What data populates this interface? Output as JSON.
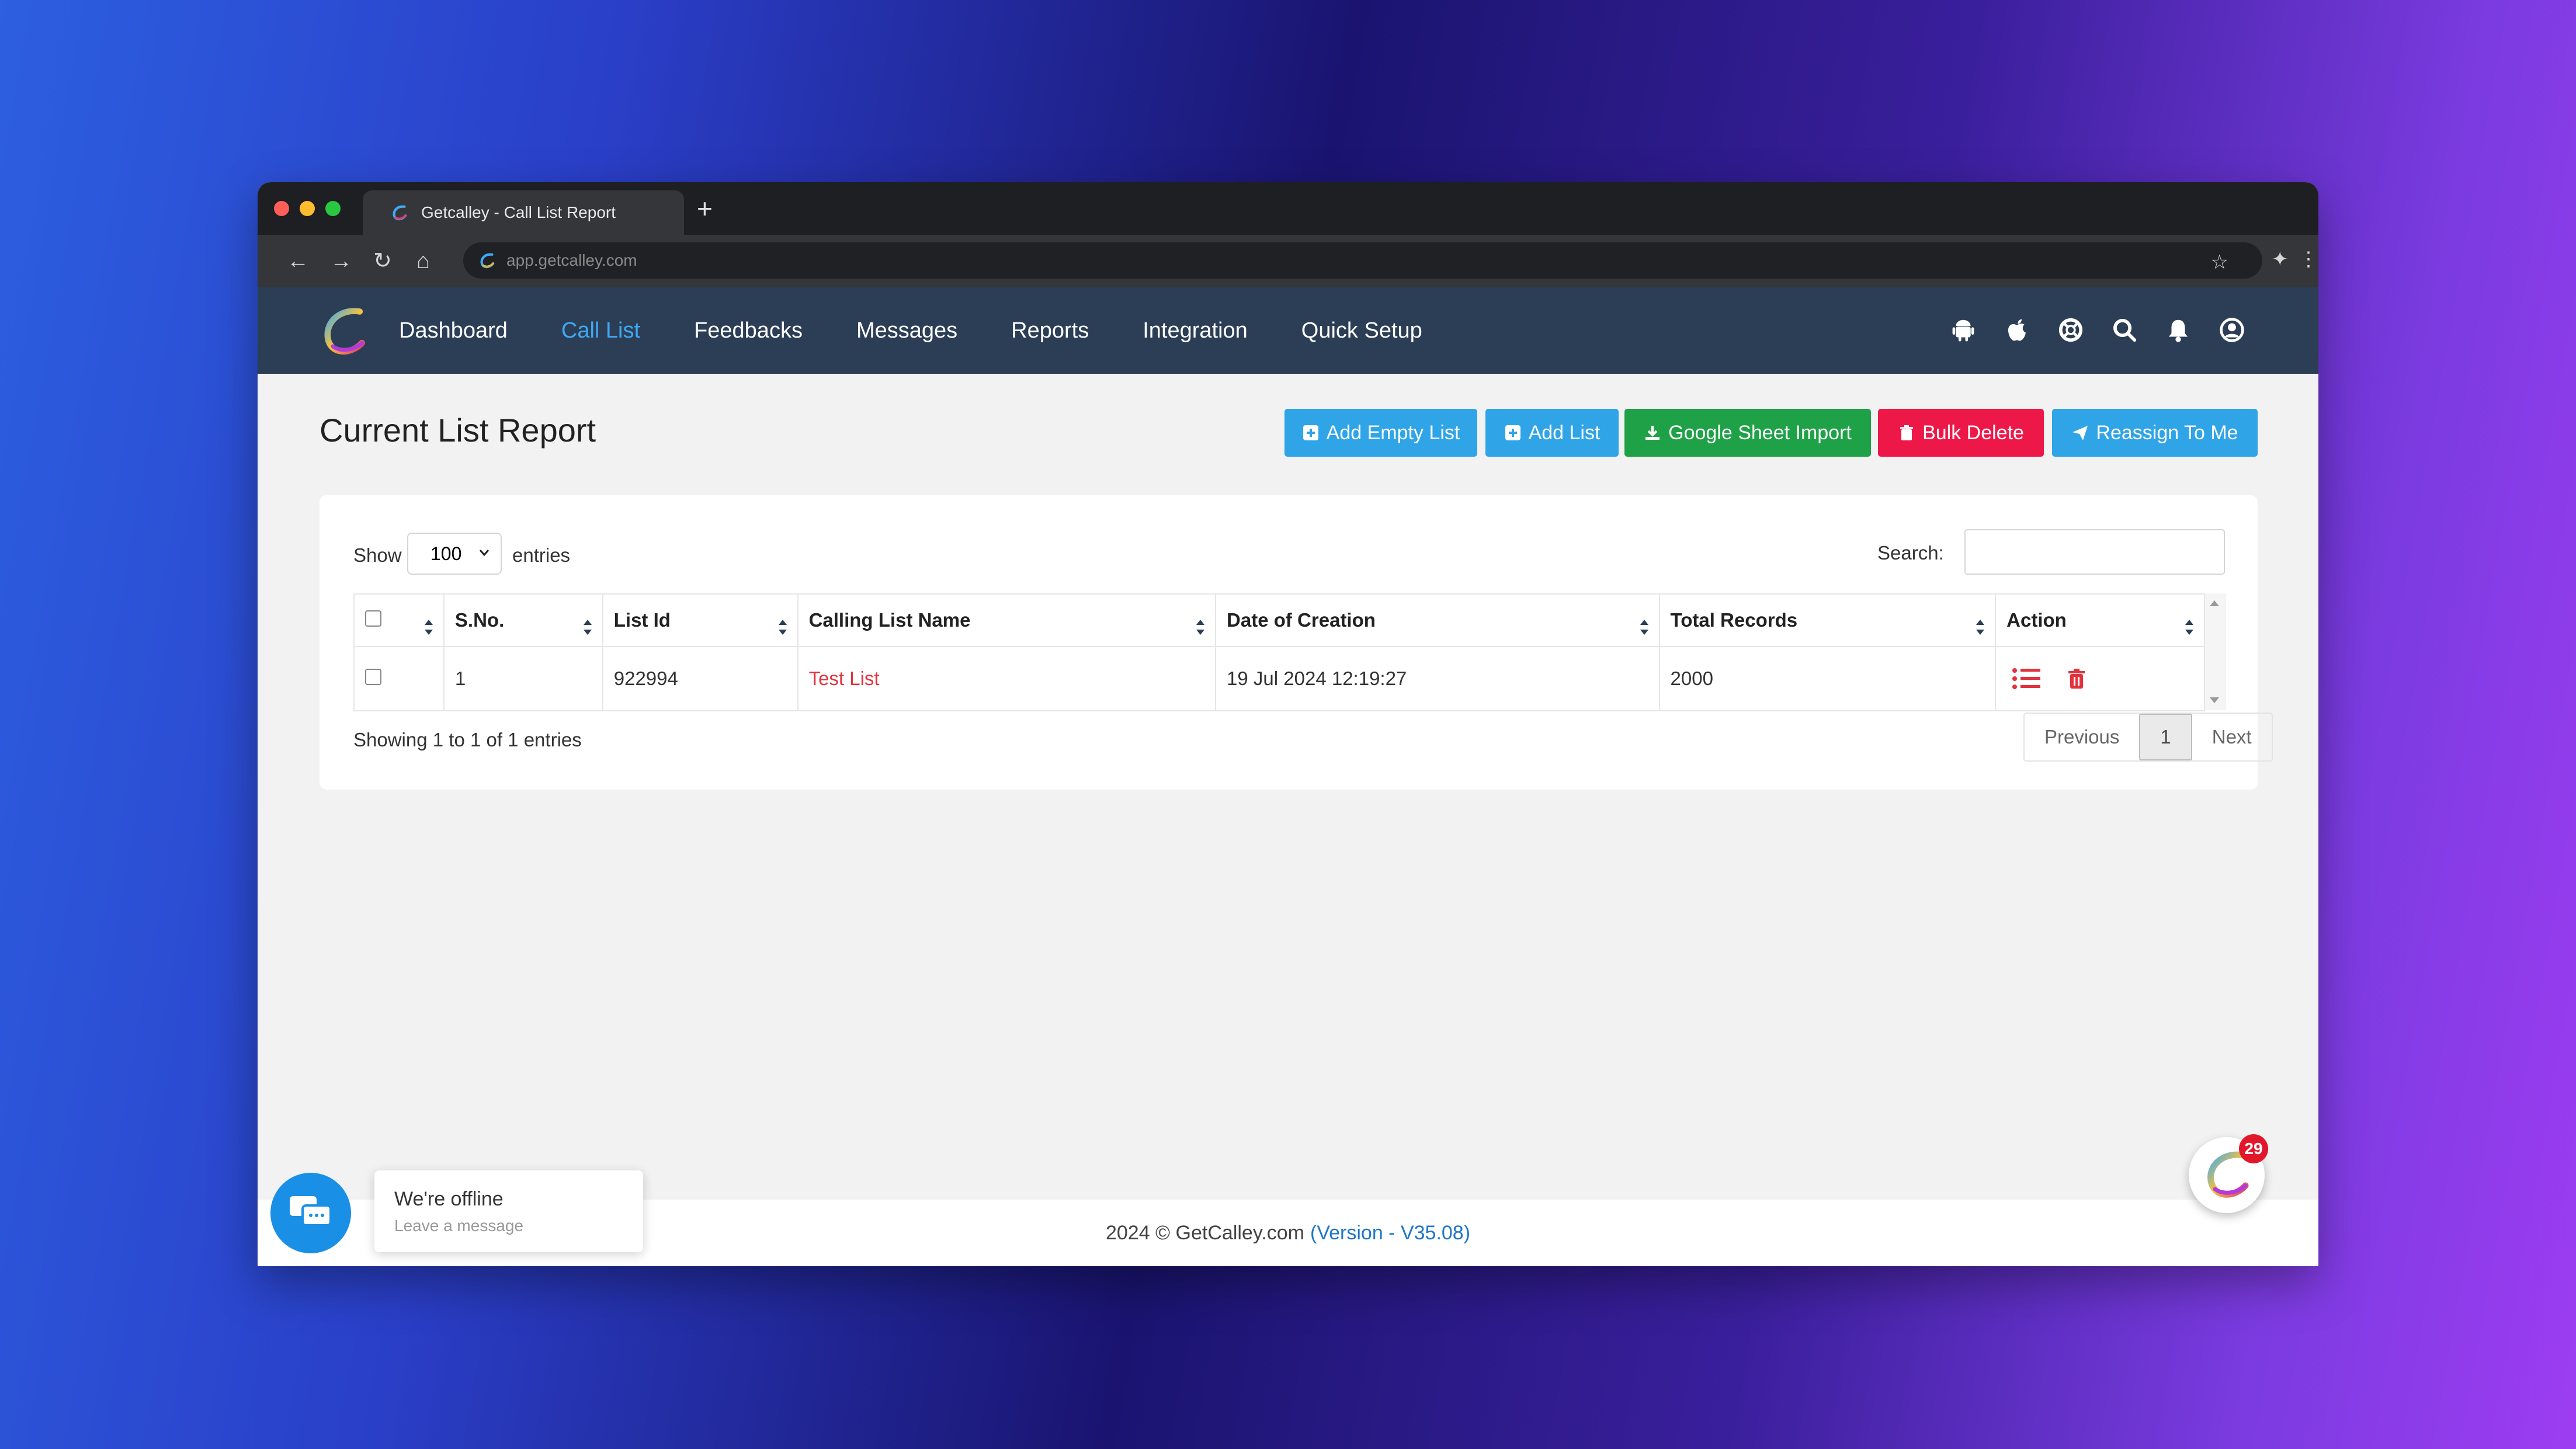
{
  "browser": {
    "tab_title": "Getcalley - Call List Report",
    "url": "app.getcalley.com"
  },
  "nav": {
    "items": [
      {
        "label": "Dashboard",
        "active": false
      },
      {
        "label": "Call List",
        "active": true
      },
      {
        "label": "Feedbacks",
        "active": false
      },
      {
        "label": "Messages",
        "active": false
      },
      {
        "label": "Reports",
        "active": false
      },
      {
        "label": "Integration",
        "active": false
      },
      {
        "label": "Quick Setup",
        "active": false
      }
    ],
    "right_icons": [
      "android-icon",
      "apple-icon",
      "lifebuoy-icon",
      "search-icon",
      "bell-icon",
      "user-icon"
    ]
  },
  "page": {
    "title": "Current List Report",
    "buttons": {
      "add_empty": "Add Empty List",
      "add_list": "Add List",
      "google_import": "Google Sheet Import",
      "bulk_delete": "Bulk Delete",
      "reassign": "Reassign To Me"
    }
  },
  "table_controls": {
    "show_label": "Show",
    "entries_value": "100",
    "entries_label": "entries",
    "search_label": "Search:",
    "search_value": ""
  },
  "table": {
    "headers": [
      "S.No.",
      "List Id",
      "Calling List Name",
      "Date of Creation",
      "Total Records",
      "Action"
    ],
    "rows": [
      {
        "sno": "1",
        "list_id": "922994",
        "name": "Test List",
        "date": "19 Jul 2024 12:19:27",
        "total": "2000"
      }
    ]
  },
  "pagination": {
    "info": "Showing 1 to 1 of 1 entries",
    "previous": "Previous",
    "current": "1",
    "next": "Next"
  },
  "footer": {
    "copyright": "2024 © GetCalley.com",
    "version": "(Version - V35.08)"
  },
  "chat": {
    "title": "We're offline",
    "subtitle": "Leave a message"
  },
  "notification_count": "29",
  "colors": {
    "nav_bg": "#2c3e55",
    "active_nav": "#3fa9f5",
    "btn_blue": "#2fa4e7",
    "btn_green": "#1ea147",
    "btn_red": "#ee1848",
    "link_red": "#e2323d"
  }
}
